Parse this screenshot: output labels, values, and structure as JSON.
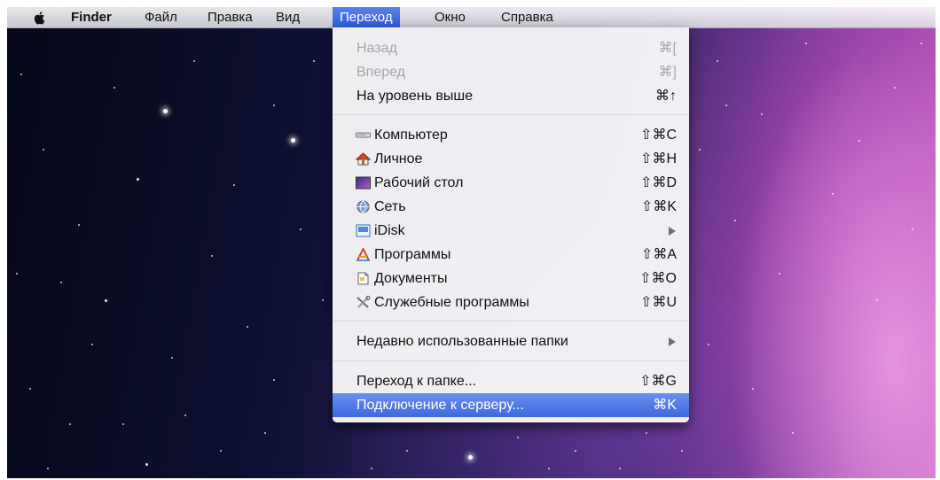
{
  "menubar": {
    "apple_icon": "apple-logo-icon",
    "items": [
      {
        "label": "Finder"
      },
      {
        "label": "Файл"
      },
      {
        "label": "Правка"
      },
      {
        "label": "Вид"
      },
      {
        "label": "Переход",
        "active": true
      },
      {
        "label": "Окно"
      },
      {
        "label": "Справка"
      }
    ]
  },
  "go_menu": {
    "sections": [
      [
        {
          "label": "Назад",
          "shortcut": "⌘[",
          "enabled": false
        },
        {
          "label": "Вперед",
          "shortcut": "⌘]",
          "enabled": false
        },
        {
          "label": "На уровень выше",
          "shortcut": "⌘↑",
          "enabled": true
        }
      ],
      [
        {
          "label": "Компьютер",
          "shortcut": "⇧⌘C",
          "icon": "computer-icon"
        },
        {
          "label": "Личное",
          "shortcut": "⇧⌘H",
          "icon": "home-icon"
        },
        {
          "label": "Рабочий стол",
          "shortcut": "⇧⌘D",
          "icon": "desktop-icon"
        },
        {
          "label": "Сеть",
          "shortcut": "⇧⌘K",
          "icon": "network-icon"
        },
        {
          "label": "iDisk",
          "submenu": true,
          "icon": "idisk-icon"
        },
        {
          "label": "Программы",
          "shortcut": "⇧⌘A",
          "icon": "applications-icon"
        },
        {
          "label": "Документы",
          "shortcut": "⇧⌘O",
          "icon": "documents-icon"
        },
        {
          "label": "Служебные программы",
          "shortcut": "⇧⌘U",
          "icon": "utilities-icon"
        }
      ],
      [
        {
          "label": "Недавно использованные папки",
          "submenu": true
        }
      ],
      [
        {
          "label": "Переход к папке...",
          "shortcut": "⇧⌘G"
        },
        {
          "label": "Подключение к серверу...",
          "shortcut": "⌘K",
          "highlighted": true
        }
      ]
    ]
  },
  "colors": {
    "highlight": "#3e69dc",
    "disabled_text": "#a6a6a6",
    "menu_bg": "#f6f6f8"
  }
}
